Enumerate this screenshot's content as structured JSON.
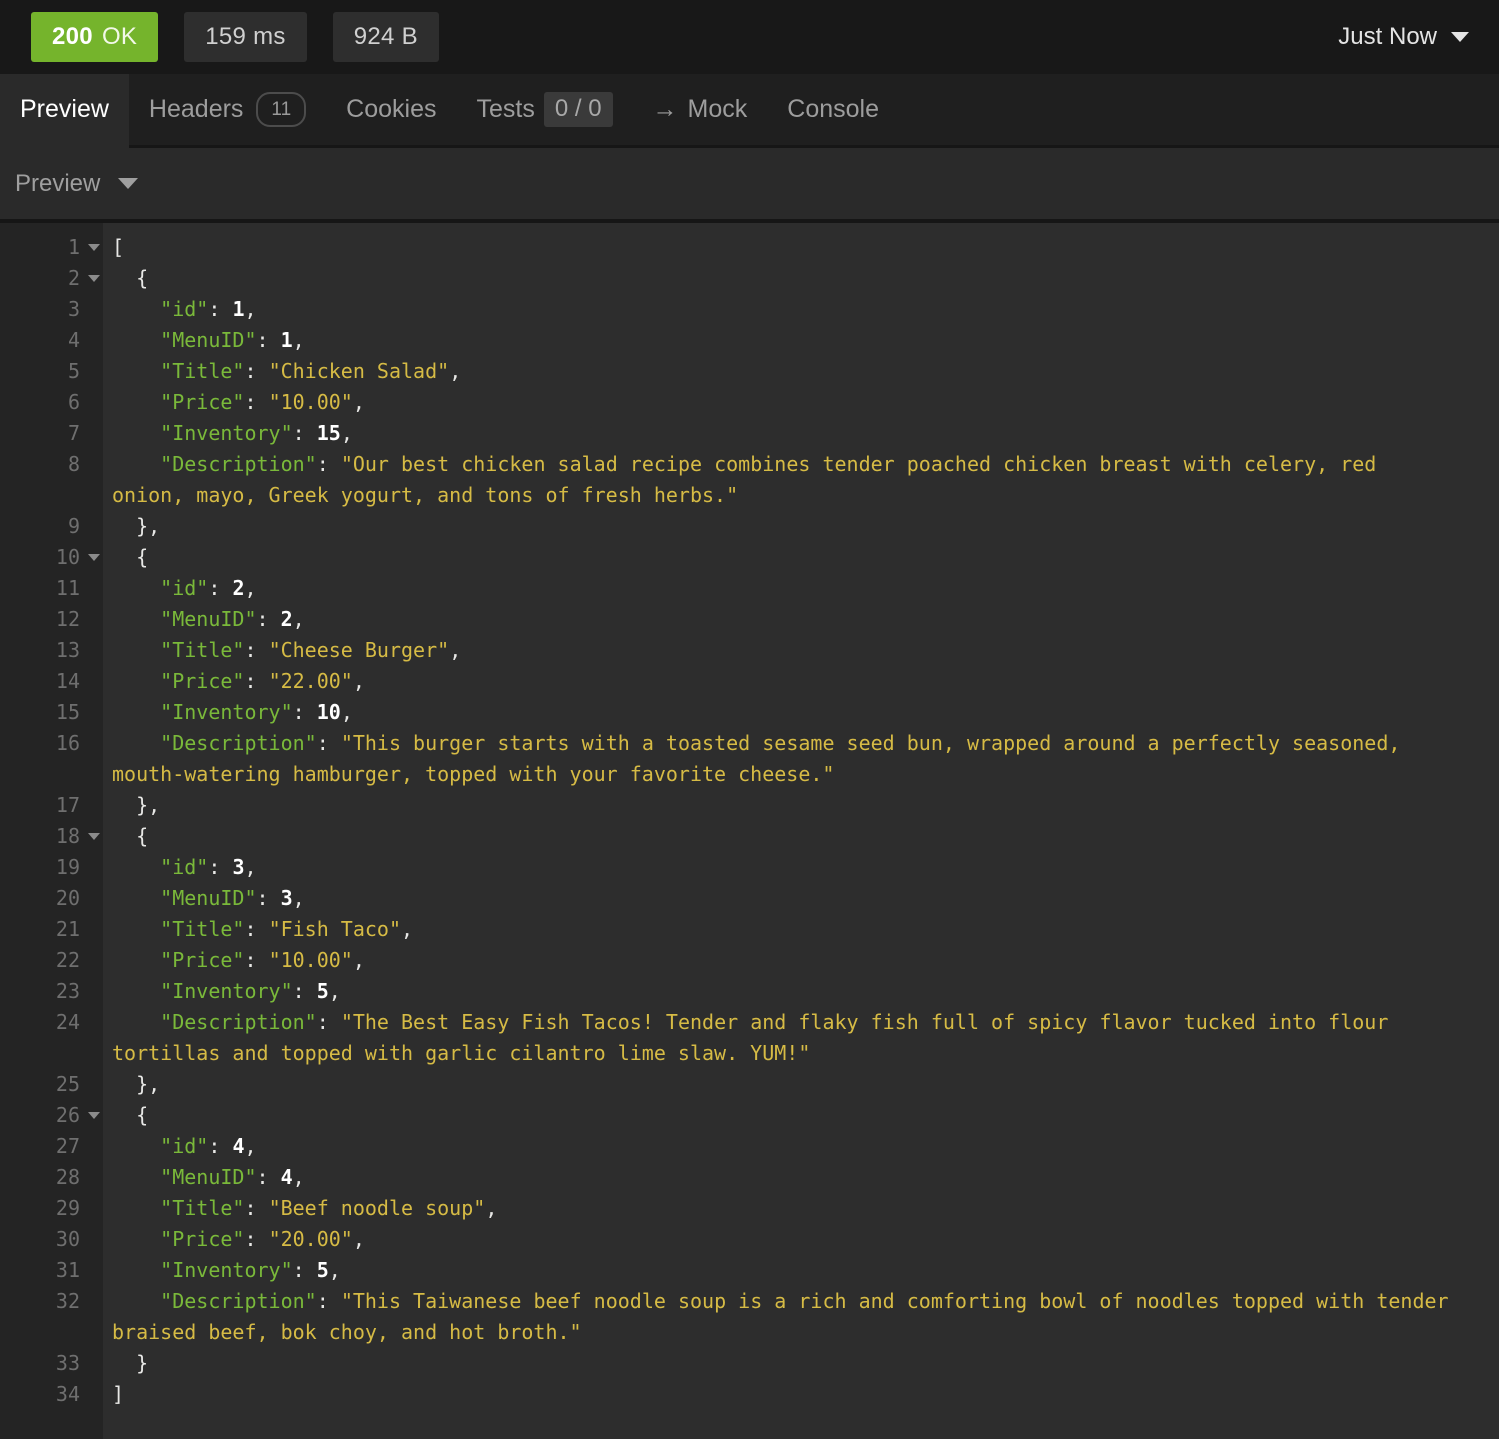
{
  "colors": {
    "status_green": "#75b42c",
    "key_green": "#7ab93a",
    "string_yellow": "#d6bb45",
    "number_white": "#ffffff",
    "punctuation": "#e8e8e6",
    "background_code": "#2d2d2d",
    "background_gutter": "#242424"
  },
  "icons": {
    "arrow_right": "→",
    "chevron_down": "▼",
    "fold_triangle": "▼"
  },
  "meta": {
    "status": "200",
    "status_text": "OK",
    "time": "159 ms",
    "size": "924 B",
    "timestamp": "Just Now"
  },
  "tabs": [
    {
      "label": "Preview",
      "active": true
    },
    {
      "label": "Headers",
      "badge": "11",
      "badge_style": "outline"
    },
    {
      "label": "Cookies"
    },
    {
      "label": "Tests",
      "badge": "0 / 0",
      "badge_style": "filled"
    },
    {
      "label": "Mock",
      "icon": "arrow-right"
    },
    {
      "label": "Console"
    }
  ],
  "preview_bar": {
    "selected": "Preview"
  },
  "code": {
    "language": "json",
    "rows": [
      {
        "n": "1",
        "fold": true,
        "seg": [
          [
            "p",
            "["
          ]
        ]
      },
      {
        "n": "2",
        "fold": true,
        "seg": [
          [
            "p",
            "  {"
          ]
        ]
      },
      {
        "n": "3",
        "seg": [
          [
            "p",
            "    "
          ],
          [
            "k",
            "\"id\""
          ],
          [
            "p",
            ": "
          ],
          [
            "n",
            "1"
          ],
          [
            "p",
            ","
          ]
        ]
      },
      {
        "n": "4",
        "seg": [
          [
            "p",
            "    "
          ],
          [
            "k",
            "\"MenuID\""
          ],
          [
            "p",
            ": "
          ],
          [
            "n",
            "1"
          ],
          [
            "p",
            ","
          ]
        ]
      },
      {
        "n": "5",
        "seg": [
          [
            "p",
            "    "
          ],
          [
            "k",
            "\"Title\""
          ],
          [
            "p",
            ": "
          ],
          [
            "s",
            "\"Chicken Salad\""
          ],
          [
            "p",
            ","
          ]
        ]
      },
      {
        "n": "6",
        "seg": [
          [
            "p",
            "    "
          ],
          [
            "k",
            "\"Price\""
          ],
          [
            "p",
            ": "
          ],
          [
            "s",
            "\"10.00\""
          ],
          [
            "p",
            ","
          ]
        ]
      },
      {
        "n": "7",
        "seg": [
          [
            "p",
            "    "
          ],
          [
            "k",
            "\"Inventory\""
          ],
          [
            "p",
            ": "
          ],
          [
            "n",
            "15"
          ],
          [
            "p",
            ","
          ]
        ]
      },
      {
        "n": "8",
        "seg": [
          [
            "p",
            "    "
          ],
          [
            "k",
            "\"Description\""
          ],
          [
            "p",
            ": "
          ],
          [
            "s",
            "\"Our best chicken salad recipe combines tender poached chicken breast with celery, red"
          ]
        ]
      },
      {
        "n": "",
        "seg": [
          [
            "s",
            "onion, mayo, Greek yogurt, and tons of fresh herbs.\""
          ]
        ]
      },
      {
        "n": "9",
        "seg": [
          [
            "p",
            "  },"
          ]
        ]
      },
      {
        "n": "10",
        "fold": true,
        "seg": [
          [
            "p",
            "  {"
          ]
        ]
      },
      {
        "n": "11",
        "seg": [
          [
            "p",
            "    "
          ],
          [
            "k",
            "\"id\""
          ],
          [
            "p",
            ": "
          ],
          [
            "n",
            "2"
          ],
          [
            "p",
            ","
          ]
        ]
      },
      {
        "n": "12",
        "seg": [
          [
            "p",
            "    "
          ],
          [
            "k",
            "\"MenuID\""
          ],
          [
            "p",
            ": "
          ],
          [
            "n",
            "2"
          ],
          [
            "p",
            ","
          ]
        ]
      },
      {
        "n": "13",
        "seg": [
          [
            "p",
            "    "
          ],
          [
            "k",
            "\"Title\""
          ],
          [
            "p",
            ": "
          ],
          [
            "s",
            "\"Cheese Burger\""
          ],
          [
            "p",
            ","
          ]
        ]
      },
      {
        "n": "14",
        "seg": [
          [
            "p",
            "    "
          ],
          [
            "k",
            "\"Price\""
          ],
          [
            "p",
            ": "
          ],
          [
            "s",
            "\"22.00\""
          ],
          [
            "p",
            ","
          ]
        ]
      },
      {
        "n": "15",
        "seg": [
          [
            "p",
            "    "
          ],
          [
            "k",
            "\"Inventory\""
          ],
          [
            "p",
            ": "
          ],
          [
            "n",
            "10"
          ],
          [
            "p",
            ","
          ]
        ]
      },
      {
        "n": "16",
        "seg": [
          [
            "p",
            "    "
          ],
          [
            "k",
            "\"Description\""
          ],
          [
            "p",
            ": "
          ],
          [
            "s",
            "\"This burger starts with a toasted sesame seed bun, wrapped around a perfectly seasoned,"
          ]
        ]
      },
      {
        "n": "",
        "seg": [
          [
            "s",
            "mouth-watering hamburger, topped with your favorite cheese.\""
          ]
        ]
      },
      {
        "n": "17",
        "seg": [
          [
            "p",
            "  },"
          ]
        ]
      },
      {
        "n": "18",
        "fold": true,
        "seg": [
          [
            "p",
            "  {"
          ]
        ]
      },
      {
        "n": "19",
        "seg": [
          [
            "p",
            "    "
          ],
          [
            "k",
            "\"id\""
          ],
          [
            "p",
            ": "
          ],
          [
            "n",
            "3"
          ],
          [
            "p",
            ","
          ]
        ]
      },
      {
        "n": "20",
        "seg": [
          [
            "p",
            "    "
          ],
          [
            "k",
            "\"MenuID\""
          ],
          [
            "p",
            ": "
          ],
          [
            "n",
            "3"
          ],
          [
            "p",
            ","
          ]
        ]
      },
      {
        "n": "21",
        "seg": [
          [
            "p",
            "    "
          ],
          [
            "k",
            "\"Title\""
          ],
          [
            "p",
            ": "
          ],
          [
            "s",
            "\"Fish Taco\""
          ],
          [
            "p",
            ","
          ]
        ]
      },
      {
        "n": "22",
        "seg": [
          [
            "p",
            "    "
          ],
          [
            "k",
            "\"Price\""
          ],
          [
            "p",
            ": "
          ],
          [
            "s",
            "\"10.00\""
          ],
          [
            "p",
            ","
          ]
        ]
      },
      {
        "n": "23",
        "seg": [
          [
            "p",
            "    "
          ],
          [
            "k",
            "\"Inventory\""
          ],
          [
            "p",
            ": "
          ],
          [
            "n",
            "5"
          ],
          [
            "p",
            ","
          ]
        ]
      },
      {
        "n": "24",
        "seg": [
          [
            "p",
            "    "
          ],
          [
            "k",
            "\"Description\""
          ],
          [
            "p",
            ": "
          ],
          [
            "s",
            "\"The Best Easy Fish Tacos! Tender and flaky fish full of spicy flavor tucked into flour"
          ]
        ]
      },
      {
        "n": "",
        "seg": [
          [
            "s",
            "tortillas and topped with garlic cilantro lime slaw. YUM!\""
          ]
        ]
      },
      {
        "n": "25",
        "seg": [
          [
            "p",
            "  },"
          ]
        ]
      },
      {
        "n": "26",
        "fold": true,
        "seg": [
          [
            "p",
            "  {"
          ]
        ]
      },
      {
        "n": "27",
        "seg": [
          [
            "p",
            "    "
          ],
          [
            "k",
            "\"id\""
          ],
          [
            "p",
            ": "
          ],
          [
            "n",
            "4"
          ],
          [
            "p",
            ","
          ]
        ]
      },
      {
        "n": "28",
        "seg": [
          [
            "p",
            "    "
          ],
          [
            "k",
            "\"MenuID\""
          ],
          [
            "p",
            ": "
          ],
          [
            "n",
            "4"
          ],
          [
            "p",
            ","
          ]
        ]
      },
      {
        "n": "29",
        "seg": [
          [
            "p",
            "    "
          ],
          [
            "k",
            "\"Title\""
          ],
          [
            "p",
            ": "
          ],
          [
            "s",
            "\"Beef noodle soup\""
          ],
          [
            "p",
            ","
          ]
        ]
      },
      {
        "n": "30",
        "seg": [
          [
            "p",
            "    "
          ],
          [
            "k",
            "\"Price\""
          ],
          [
            "p",
            ": "
          ],
          [
            "s",
            "\"20.00\""
          ],
          [
            "p",
            ","
          ]
        ]
      },
      {
        "n": "31",
        "seg": [
          [
            "p",
            "    "
          ],
          [
            "k",
            "\"Inventory\""
          ],
          [
            "p",
            ": "
          ],
          [
            "n",
            "5"
          ],
          [
            "p",
            ","
          ]
        ]
      },
      {
        "n": "32",
        "seg": [
          [
            "p",
            "    "
          ],
          [
            "k",
            "\"Description\""
          ],
          [
            "p",
            ": "
          ],
          [
            "s",
            "\"This Taiwanese beef noodle soup is a rich and comforting bowl of noodles topped with tender"
          ]
        ]
      },
      {
        "n": "",
        "seg": [
          [
            "s",
            "braised beef, bok choy, and hot broth.\""
          ]
        ]
      },
      {
        "n": "33",
        "seg": [
          [
            "p",
            "  }"
          ]
        ]
      },
      {
        "n": "34",
        "seg": [
          [
            "p",
            "]"
          ]
        ]
      }
    ]
  }
}
